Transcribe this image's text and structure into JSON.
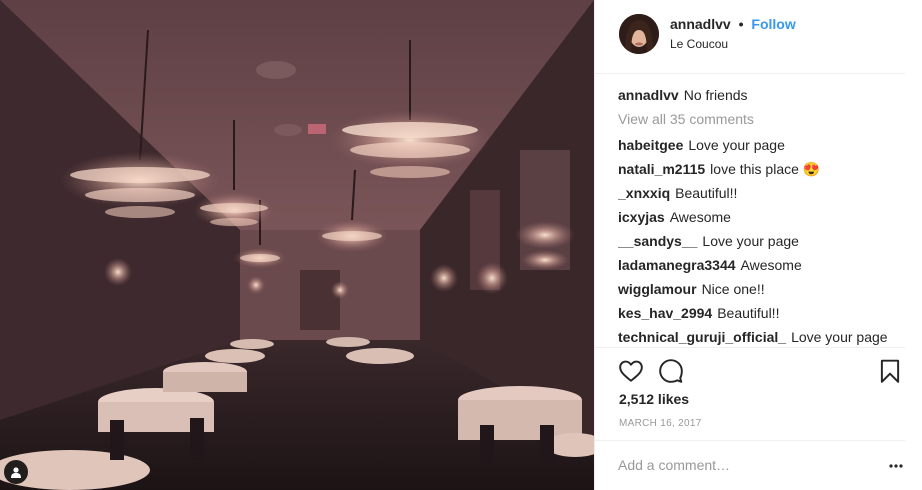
{
  "post": {
    "username": "annadlvv",
    "separator": "•",
    "follow_label": "Follow",
    "location": "Le Coucou",
    "caption": {
      "user": "annadlvv",
      "text": "No friends"
    },
    "view_all_label": "View all 35 comments",
    "comments": [
      {
        "user": "habeitgee",
        "text": "Love your page"
      },
      {
        "user": "natali_m2115",
        "text": "love this place 😍"
      },
      {
        "user": "_xnxxiq",
        "text": "Beautiful!!"
      },
      {
        "user": "icxyjas",
        "text": "Awesome"
      },
      {
        "user": "__sandys__",
        "text": "Love your page"
      },
      {
        "user": "ladamanegra3344",
        "text": "Awesome"
      },
      {
        "user": "wigglamour",
        "text": "Nice one!!"
      },
      {
        "user": "kes_hav_2994",
        "text": "Beautiful!!"
      },
      {
        "user": "technical_guruji_official_",
        "text": "Love your page"
      }
    ],
    "likes_label": "2,512 likes",
    "date": "MARCH 16, 2017",
    "comment_placeholder": "Add a comment…",
    "more_label": "•••"
  },
  "icons": {
    "like": "heart-outline",
    "comment": "speech-bubble",
    "save": "bookmark-outline",
    "tag": "person-tag"
  },
  "colors": {
    "follow": "#3897f0",
    "muted": "#999999",
    "text": "#262626",
    "divider": "#efefef"
  }
}
